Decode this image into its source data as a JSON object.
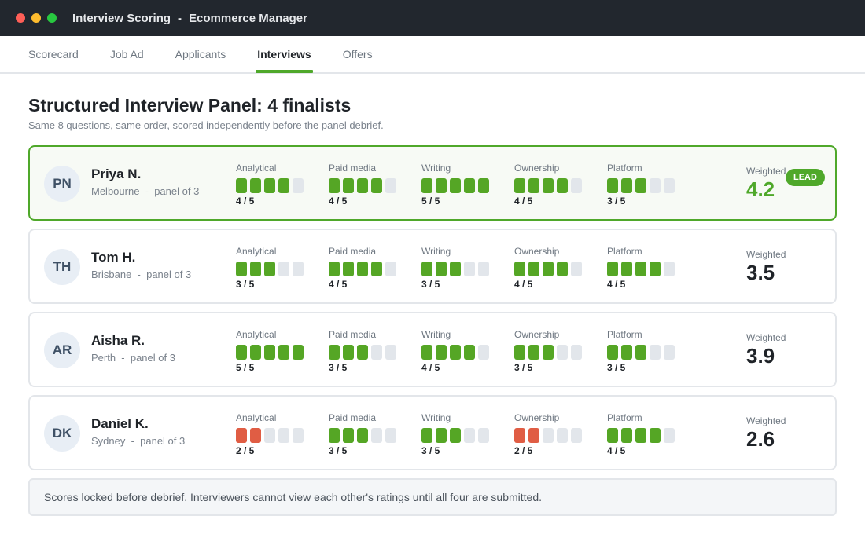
{
  "window": {
    "title": "Interview Scoring",
    "subtitle": "Ecommerce Manager",
    "separator": "-"
  },
  "tabs": [
    {
      "label": "Scorecard",
      "active": false
    },
    {
      "label": "Job Ad",
      "active": false
    },
    {
      "label": "Applicants",
      "active": false
    },
    {
      "label": "Interviews",
      "active": true
    },
    {
      "label": "Offers",
      "active": false
    }
  ],
  "page": {
    "title": "Structured Interview Panel: 4 finalists",
    "subtitle": "Same 8 questions, same order, scored independently before the panel debrief."
  },
  "colors": {
    "accent": "#4fa82a",
    "score_on": "#55a625",
    "score_low": "#e05d44",
    "score_off": "#e2e6eb"
  },
  "weighted_label": "Weighted",
  "lead_badge": "LEAD",
  "candidates": [
    {
      "initials": "PN",
      "name": "Priya N.",
      "location": "Melbourne  -  panel of 3",
      "lead": true,
      "weighted": "4.2",
      "criteria": [
        {
          "label": "Analytical",
          "score": 4,
          "max": 5,
          "text": "4 / 5"
        },
        {
          "label": "Paid media",
          "score": 4,
          "max": 5,
          "text": "4 / 5"
        },
        {
          "label": "Writing",
          "score": 5,
          "max": 5,
          "text": "5 / 5"
        },
        {
          "label": "Ownership",
          "score": 4,
          "max": 5,
          "text": "4 / 5"
        },
        {
          "label": "Platform",
          "score": 3,
          "max": 5,
          "text": "3 / 5"
        }
      ]
    },
    {
      "initials": "TH",
      "name": "Tom H.",
      "location": "Brisbane  -  panel of 3",
      "lead": false,
      "weighted": "3.5",
      "criteria": [
        {
          "label": "Analytical",
          "score": 3,
          "max": 5,
          "text": "3 / 5"
        },
        {
          "label": "Paid media",
          "score": 4,
          "max": 5,
          "text": "4 / 5"
        },
        {
          "label": "Writing",
          "score": 3,
          "max": 5,
          "text": "3 / 5"
        },
        {
          "label": "Ownership",
          "score": 4,
          "max": 5,
          "text": "4 / 5"
        },
        {
          "label": "Platform",
          "score": 4,
          "max": 5,
          "text": "4 / 5"
        }
      ]
    },
    {
      "initials": "AR",
      "name": "Aisha R.",
      "location": "Perth  -  panel of 3",
      "lead": false,
      "weighted": "3.9",
      "criteria": [
        {
          "label": "Analytical",
          "score": 5,
          "max": 5,
          "text": "5 / 5"
        },
        {
          "label": "Paid media",
          "score": 3,
          "max": 5,
          "text": "3 / 5"
        },
        {
          "label": "Writing",
          "score": 4,
          "max": 5,
          "text": "4 / 5"
        },
        {
          "label": "Ownership",
          "score": 3,
          "max": 5,
          "text": "3 / 5"
        },
        {
          "label": "Platform",
          "score": 3,
          "max": 5,
          "text": "3 / 5"
        }
      ]
    },
    {
      "initials": "DK",
      "name": "Daniel K.",
      "location": "Sydney  -  panel of 3",
      "lead": false,
      "weighted": "2.6",
      "criteria": [
        {
          "label": "Analytical",
          "score": 2,
          "max": 5,
          "text": "2 / 5",
          "low": true
        },
        {
          "label": "Paid media",
          "score": 3,
          "max": 5,
          "text": "3 / 5"
        },
        {
          "label": "Writing",
          "score": 3,
          "max": 5,
          "text": "3 / 5"
        },
        {
          "label": "Ownership",
          "score": 2,
          "max": 5,
          "text": "2 / 5",
          "low": true
        },
        {
          "label": "Platform",
          "score": 4,
          "max": 5,
          "text": "4 / 5"
        }
      ]
    }
  ],
  "footnote": "Scores locked before debrief. Interviewers cannot view each other's ratings until all four are submitted."
}
